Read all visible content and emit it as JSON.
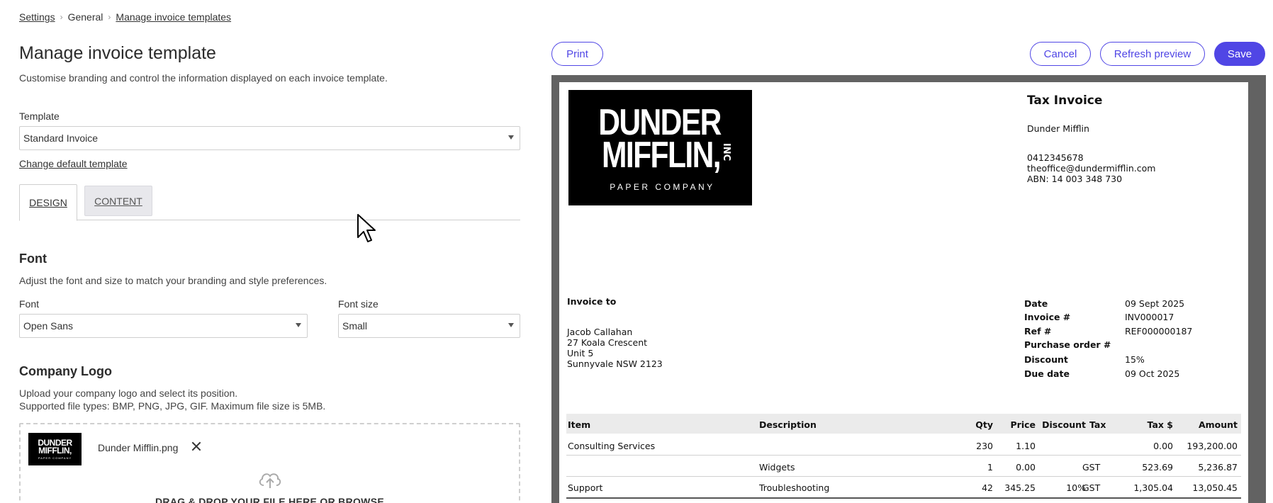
{
  "breadcrumb": {
    "settings": "Settings",
    "general": "General",
    "current": "Manage invoice templates"
  },
  "page": {
    "title": "Manage invoice template",
    "subtitle": "Customise branding and control the information displayed on each invoice template."
  },
  "template": {
    "label": "Template",
    "value": "Standard Invoice",
    "change_link": "Change default template"
  },
  "tabs": [
    {
      "label": "DESIGN",
      "active": true
    },
    {
      "label": "CONTENT",
      "active": false
    }
  ],
  "font_section": {
    "title": "Font",
    "description": "Adjust the font and size to match your branding and style preferences.",
    "font_label": "Font",
    "font_value": "Open Sans",
    "size_label": "Font size",
    "size_value": "Small"
  },
  "logo_section": {
    "title": "Company Logo",
    "description_1": "Upload your company logo and select its position.",
    "description_2": "Supported file types: BMP, PNG, JPG, GIF. Maximum file size is 5MB.",
    "filename": "Dunder Mifflin.png",
    "drag_text": "DRAG & DROP YOUR FILE HERE OR BROWSE"
  },
  "actions": {
    "print": "Print",
    "cancel": "Cancel",
    "refresh": "Refresh preview",
    "save": "Save"
  },
  "colors": {
    "accent": "#5046e5",
    "preview_bg": "#626262"
  },
  "invoice": {
    "logo": {
      "line1": "DUNDER",
      "line2": "MIFFLIN,",
      "inc": "INC",
      "tagline": "PAPER COMPANY"
    },
    "title": "Tax Invoice",
    "company": "Dunder Mifflin",
    "phone": "0412345678",
    "email": "theoffice@dundermifflin.com",
    "abn": "ABN: 14 003 348 730",
    "invoice_to_label": "Invoice to",
    "customer": {
      "name": "Jacob Callahan",
      "line1": "27 Koala Crescent",
      "line2": "Unit 5",
      "line3": "Sunnyvale NSW 2123"
    },
    "meta": [
      {
        "k": "Date",
        "v": "09 Sept 2025"
      },
      {
        "k": "Invoice #",
        "v": "INV000017"
      },
      {
        "k": "Ref #",
        "v": "REF000000187"
      },
      {
        "k": "Purchase order #",
        "v": ""
      },
      {
        "k": "Discount",
        "v": "15%"
      },
      {
        "k": "Due date",
        "v": "09 Oct 2025"
      }
    ],
    "columns": {
      "item": "Item",
      "description": "Description",
      "qty": "Qty",
      "price": "Price",
      "discount": "Discount",
      "tax": "Tax",
      "tax_amt": "Tax $",
      "amount": "Amount"
    },
    "rows": [
      {
        "item": "Consulting Services",
        "description": "",
        "qty": "230",
        "price": "1.10",
        "discount": "",
        "tax": "",
        "tax_amt": "0.00",
        "amount": "193,200.00"
      },
      {
        "item": "",
        "description": "Widgets",
        "qty": "1",
        "price": "0.00",
        "discount": "",
        "tax": "GST",
        "tax_amt": "523.69",
        "amount": "5,236.87"
      },
      {
        "item": "Support",
        "description": "Troubleshooting",
        "qty": "42",
        "price": "345.25",
        "discount": "10%",
        "tax": "GST",
        "tax_amt": "1,305.04",
        "amount": "13,050.45"
      }
    ]
  }
}
